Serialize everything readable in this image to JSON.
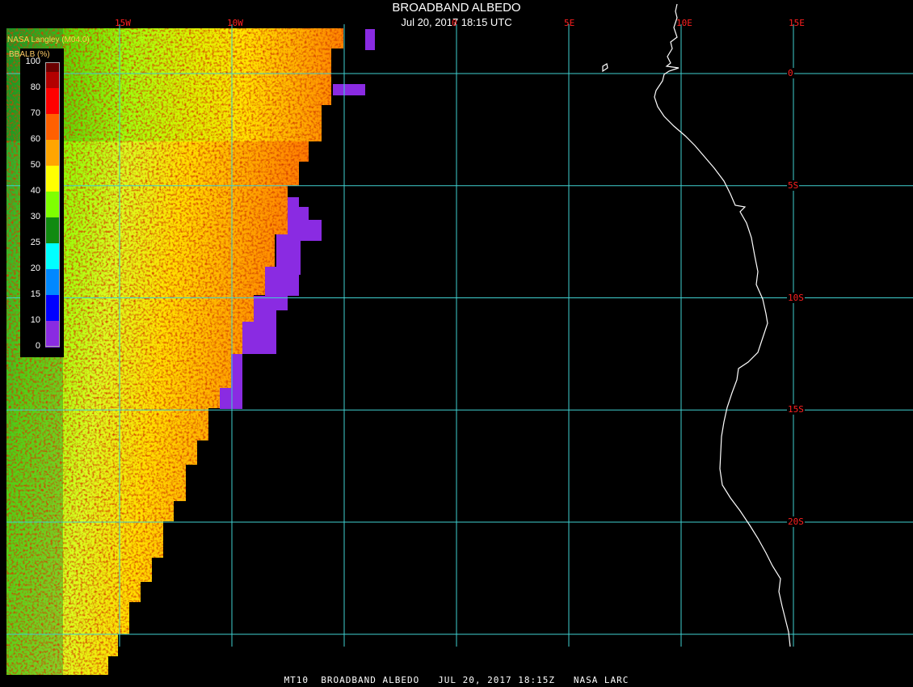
{
  "header": {
    "title": "BROADBAND ALBEDO",
    "subtitle": "Jul 20, 2017 18:15 UTC",
    "credit": "NASA Langley (M04.0)"
  },
  "footer": {
    "text": "MT10  BROADBAND ALBEDO   JUL 20, 2017 18:15Z   NASA LARC"
  },
  "legend": {
    "title": "BBALB (%)",
    "ticks": [
      "100",
      "80",
      "70",
      "60",
      "50",
      "40",
      "30",
      "25",
      "20",
      "15",
      "10",
      "0"
    ],
    "colors": [
      "#6b0000",
      "#b30000",
      "#ff0000",
      "#ff6000",
      "#ffa500",
      "#ffff00",
      "#7fff00",
      "#108a10",
      "#00ffff",
      "#0088ff",
      "#0000ff",
      "#8a2be2"
    ]
  },
  "map": {
    "grid_color": "#40d0d0",
    "label_color": "#ff2020",
    "coast_color": "#ffffff",
    "no_data_color": "#8a2be2",
    "longitudes": [
      {
        "value": -15,
        "label": "15W"
      },
      {
        "value": -10,
        "label": "10W"
      },
      {
        "value": 0,
        "label": "0"
      },
      {
        "value": 5,
        "label": "5E"
      },
      {
        "value": 10,
        "label": "10E"
      },
      {
        "value": 15,
        "label": "15E"
      }
    ],
    "latitudes": [
      {
        "value": 0,
        "label": "0"
      },
      {
        "value": -5,
        "label": "5S"
      },
      {
        "value": -10,
        "label": "10S"
      },
      {
        "value": -15,
        "label": "15S"
      },
      {
        "value": -20,
        "label": "20S"
      }
    ],
    "extra_gridlines": {
      "longitudes": [
        -5
      ],
      "latitudes": [
        -25
      ]
    }
  }
}
